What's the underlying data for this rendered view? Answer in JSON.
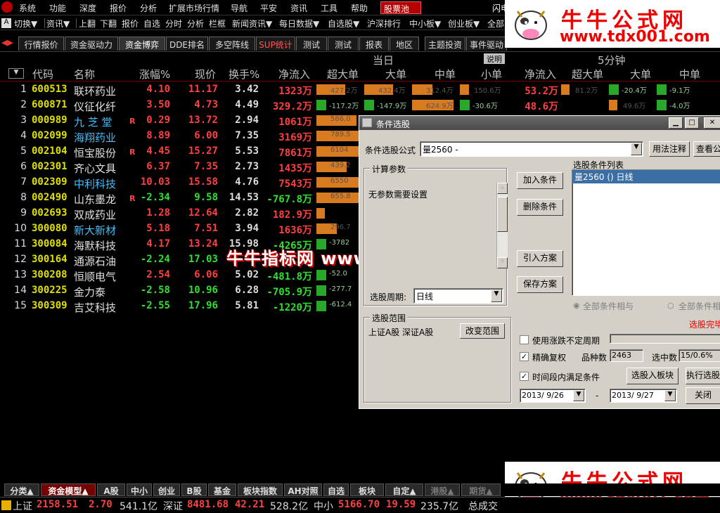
{
  "menu": {
    "items": [
      "系统",
      "功能",
      "深度",
      "报价",
      "分析",
      "扩展市场行情",
      "导航",
      "平安",
      "资讯",
      "工具",
      "帮助"
    ],
    "stock_pool": "股票池",
    "flash": "闪电"
  },
  "toolbar": {
    "items": [
      "切换▼",
      "资讯▼",
      "上翻",
      "下翻",
      "报价",
      "自选",
      "分时",
      "分析",
      "栏框",
      "新闻资讯▼",
      "每日数据▼",
      "自选股▼",
      "沪深排行",
      "中小板▼",
      "创业板▼",
      "全部"
    ]
  },
  "tabs": [
    "行情报价",
    "资金驱动力",
    "资金博弈",
    "DDE排名",
    "多空阵线",
    "SUP统计",
    "测试",
    "测试",
    "报表",
    "地区",
    "主题投资",
    "事件驱动"
  ],
  "header": {
    "today": "当日",
    "five_min": "5分钟",
    "explain": "说明",
    "cols": [
      "代码",
      "名称",
      "涨幅%",
      "现价",
      "换手%",
      "净流入",
      "超大单",
      "大单",
      "中单",
      "小单",
      "净流入",
      "超大单",
      "大单",
      "中单"
    ]
  },
  "rows": [
    {
      "i": "1",
      "code": "600513",
      "name": "联环药业",
      "chg": "4.10",
      "price": "11.17",
      "turn": "3.42",
      "net": "1323万",
      "r": "",
      "dir": "up",
      "c1": "427.2万",
      "c2": "432.4万",
      "c3": "312.4万",
      "c4": "150.6万",
      "n5": "53.2万",
      "d1": "81.2万",
      "d2": "-20.4万",
      "d3": "-9.1万"
    },
    {
      "i": "2",
      "code": "600871",
      "name": "仪征化纤",
      "chg": "3.50",
      "price": "4.73",
      "turn": "4.49",
      "net": "329.2万",
      "r": "",
      "dir": "up",
      "c1": "-117.2万",
      "c2": "-147.9万",
      "c3": "624.9万",
      "c4": "-30.6万",
      "n5": "48.6万",
      "d1": "",
      "d2": "49.6万",
      "d3": "-4.0万"
    },
    {
      "i": "3",
      "code": "000989",
      "name": "九 芝 堂",
      "chg": "0.29",
      "price": "13.72",
      "turn": "2.94",
      "net": "1061万",
      "r": "R",
      "dir": "up",
      "c1": "586.0",
      "c2": "",
      "c3": "",
      "c4": "",
      "n5": "",
      "d1": "",
      "d2": "",
      "d3": ""
    },
    {
      "i": "4",
      "code": "002099",
      "name": "海翔药业",
      "chg": "8.89",
      "price": "6.00",
      "turn": "7.35",
      "net": "3169万",
      "r": "",
      "dir": "up",
      "c1": "789.5",
      "c2": "",
      "c3": "",
      "c4": "",
      "n5": "",
      "d1": "",
      "d2": "",
      "d3": ""
    },
    {
      "i": "5",
      "code": "002104",
      "name": "恒宝股份",
      "chg": "4.45",
      "price": "15.27",
      "turn": "5.53",
      "net": "7861万",
      "r": "R",
      "dir": "up",
      "c1": "6104",
      "c2": "",
      "c3": "",
      "c4": "",
      "n5": "",
      "d1": "",
      "d2": "",
      "d3": ""
    },
    {
      "i": "6",
      "code": "002301",
      "name": "齐心文具",
      "chg": "6.37",
      "price": "7.35",
      "turn": "2.73",
      "net": "1435万",
      "r": "",
      "dir": "up",
      "c1": "439.2",
      "c2": "",
      "c3": "",
      "c4": "",
      "n5": "",
      "d1": "",
      "d2": "",
      "d3": ""
    },
    {
      "i": "7",
      "code": "002309",
      "name": "中利科技",
      "chg": "10.03",
      "price": "15.58",
      "turn": "4.76",
      "net": "7543万",
      "r": "",
      "dir": "up",
      "c1": "6550",
      "c2": "",
      "c3": "",
      "c4": "",
      "n5": "",
      "d1": "",
      "d2": "",
      "d3": ""
    },
    {
      "i": "8",
      "code": "002490",
      "name": "山东墨龙",
      "chg": "-2.34",
      "price": "9.58",
      "turn": "14.53",
      "net": "-767.8万",
      "r": "R",
      "dir": "down",
      "c1": "655.8",
      "c2": "",
      "c3": "",
      "c4": "",
      "n5": "",
      "d1": "",
      "d2": "",
      "d3": ""
    },
    {
      "i": "9",
      "code": "002693",
      "name": "双成药业",
      "chg": "1.28",
      "price": "12.64",
      "turn": "2.82",
      "net": "182.9万",
      "r": "",
      "dir": "up",
      "c1": "",
      "c2": "",
      "c3": "",
      "c4": "",
      "n5": "",
      "d1": "",
      "d2": "",
      "d3": ""
    },
    {
      "i": "10",
      "code": "300080",
      "name": "新大新材",
      "chg": "5.18",
      "price": "7.51",
      "turn": "3.94",
      "net": "1636万",
      "r": "",
      "dir": "up",
      "c1": "296.7",
      "c2": "",
      "c3": "",
      "c4": "",
      "n5": "",
      "d1": "",
      "d2": "",
      "d3": ""
    },
    {
      "i": "11",
      "code": "300084",
      "name": "海默科技",
      "chg": "4.17",
      "price": "13.24",
      "turn": "15.98",
      "net": "-4265万",
      "r": "",
      "dir": "up",
      "c1": "-3782",
      "c2": "",
      "c3": "",
      "c4": "",
      "n5": "",
      "d1": "",
      "d2": "",
      "d3": ""
    },
    {
      "i": "12",
      "code": "300164",
      "name": "通源石油",
      "chg": "-2.24",
      "price": "17.03",
      "turn": "",
      "net": "",
      "r": "",
      "dir": "down",
      "c1": "",
      "c2": "",
      "c3": "",
      "c4": "",
      "n5": "",
      "d1": "",
      "d2": "",
      "d3": ""
    },
    {
      "i": "13",
      "code": "300208",
      "name": "恒顺电气",
      "chg": "2.54",
      "price": "6.06",
      "turn": "5.02",
      "net": "-481.8万",
      "r": "",
      "dir": "up",
      "c1": "-52.0",
      "c2": "",
      "c3": "",
      "c4": "",
      "n5": "",
      "d1": "",
      "d2": "",
      "d3": ""
    },
    {
      "i": "14",
      "code": "300225",
      "name": "金力泰",
      "chg": "-2.58",
      "price": "10.96",
      "turn": "6.28",
      "net": "-705.9万",
      "r": "",
      "dir": "down",
      "c1": "-277.7",
      "c2": "",
      "c3": "",
      "c4": "",
      "n5": "",
      "d1": "",
      "d2": "",
      "d3": ""
    },
    {
      "i": "15",
      "code": "300309",
      "name": "吉艾科技",
      "chg": "-2.55",
      "price": "17.96",
      "turn": "5.81",
      "net": "-1220万",
      "r": "",
      "dir": "down",
      "c1": "-612.4",
      "c2": "",
      "c3": "",
      "c4": "",
      "n5": "",
      "d1": "",
      "d2": "",
      "d3": ""
    }
  ],
  "dialog": {
    "title": "条件选股",
    "formula_label": "条件选股公式",
    "formula_value": "量2560   -",
    "usage_btn": "用法注释",
    "view_btn": "查看公式",
    "params_group": "计算参数",
    "params_text": "无参数需要设置",
    "add_btn": "加入条件",
    "del_btn": "删除条件",
    "import_btn": "引入方案",
    "save_btn": "保存方案",
    "list_label": "选股条件列表",
    "list_item": "量2560  () 日线",
    "period_label": "选股周期:",
    "period_value": "日线",
    "range_group": "选股范围",
    "range_text": "上证A股 深证A股",
    "change_range_btn": "改变范围",
    "all_and": "全部条件相与",
    "all_or": "全部条件相或",
    "done_text": "选股完毕",
    "opt_uncertain": "使用涨跌不定周期",
    "opt_adjust": "精确复权",
    "count_label": "品种数",
    "count_value": "2463",
    "selected_label": "选中数",
    "selected_value": "15/0.6%",
    "opt_timerange": "时间段内满足条件",
    "to_board_btn": "选股入板块",
    "exec_btn": "执行选股",
    "date_from": "2013/ 9/26",
    "date_dash": "-",
    "date_to": "2013/ 9/27",
    "close_btn": "关闭"
  },
  "watermark": "牛牛指标网 www.tdx001.com",
  "ad": {
    "name": "牛牛公式网",
    "url": "www.tdx001.com"
  },
  "bottom_tabs": [
    "分类▲",
    "资金模型▲",
    "A股",
    "中小",
    "创业",
    "B股",
    "基金",
    "板块指数",
    "AH对照",
    "自选",
    "板块",
    "自定▲",
    "港股▲",
    "期货▲"
  ],
  "status": {
    "sh_label": "上证",
    "sh_index": "2158.51",
    "sh_chg": "2.70",
    "sh_vol": "541.1亿",
    "sz_label": "深证",
    "sz_index": "8481.68",
    "sz_chg": "42.21",
    "sz_vol": "528.2亿",
    "zx_label": "中小",
    "zx_index": "5166.70",
    "zx_chg": "19.59",
    "zx_vol": "235.7亿",
    "total": "总成交"
  }
}
